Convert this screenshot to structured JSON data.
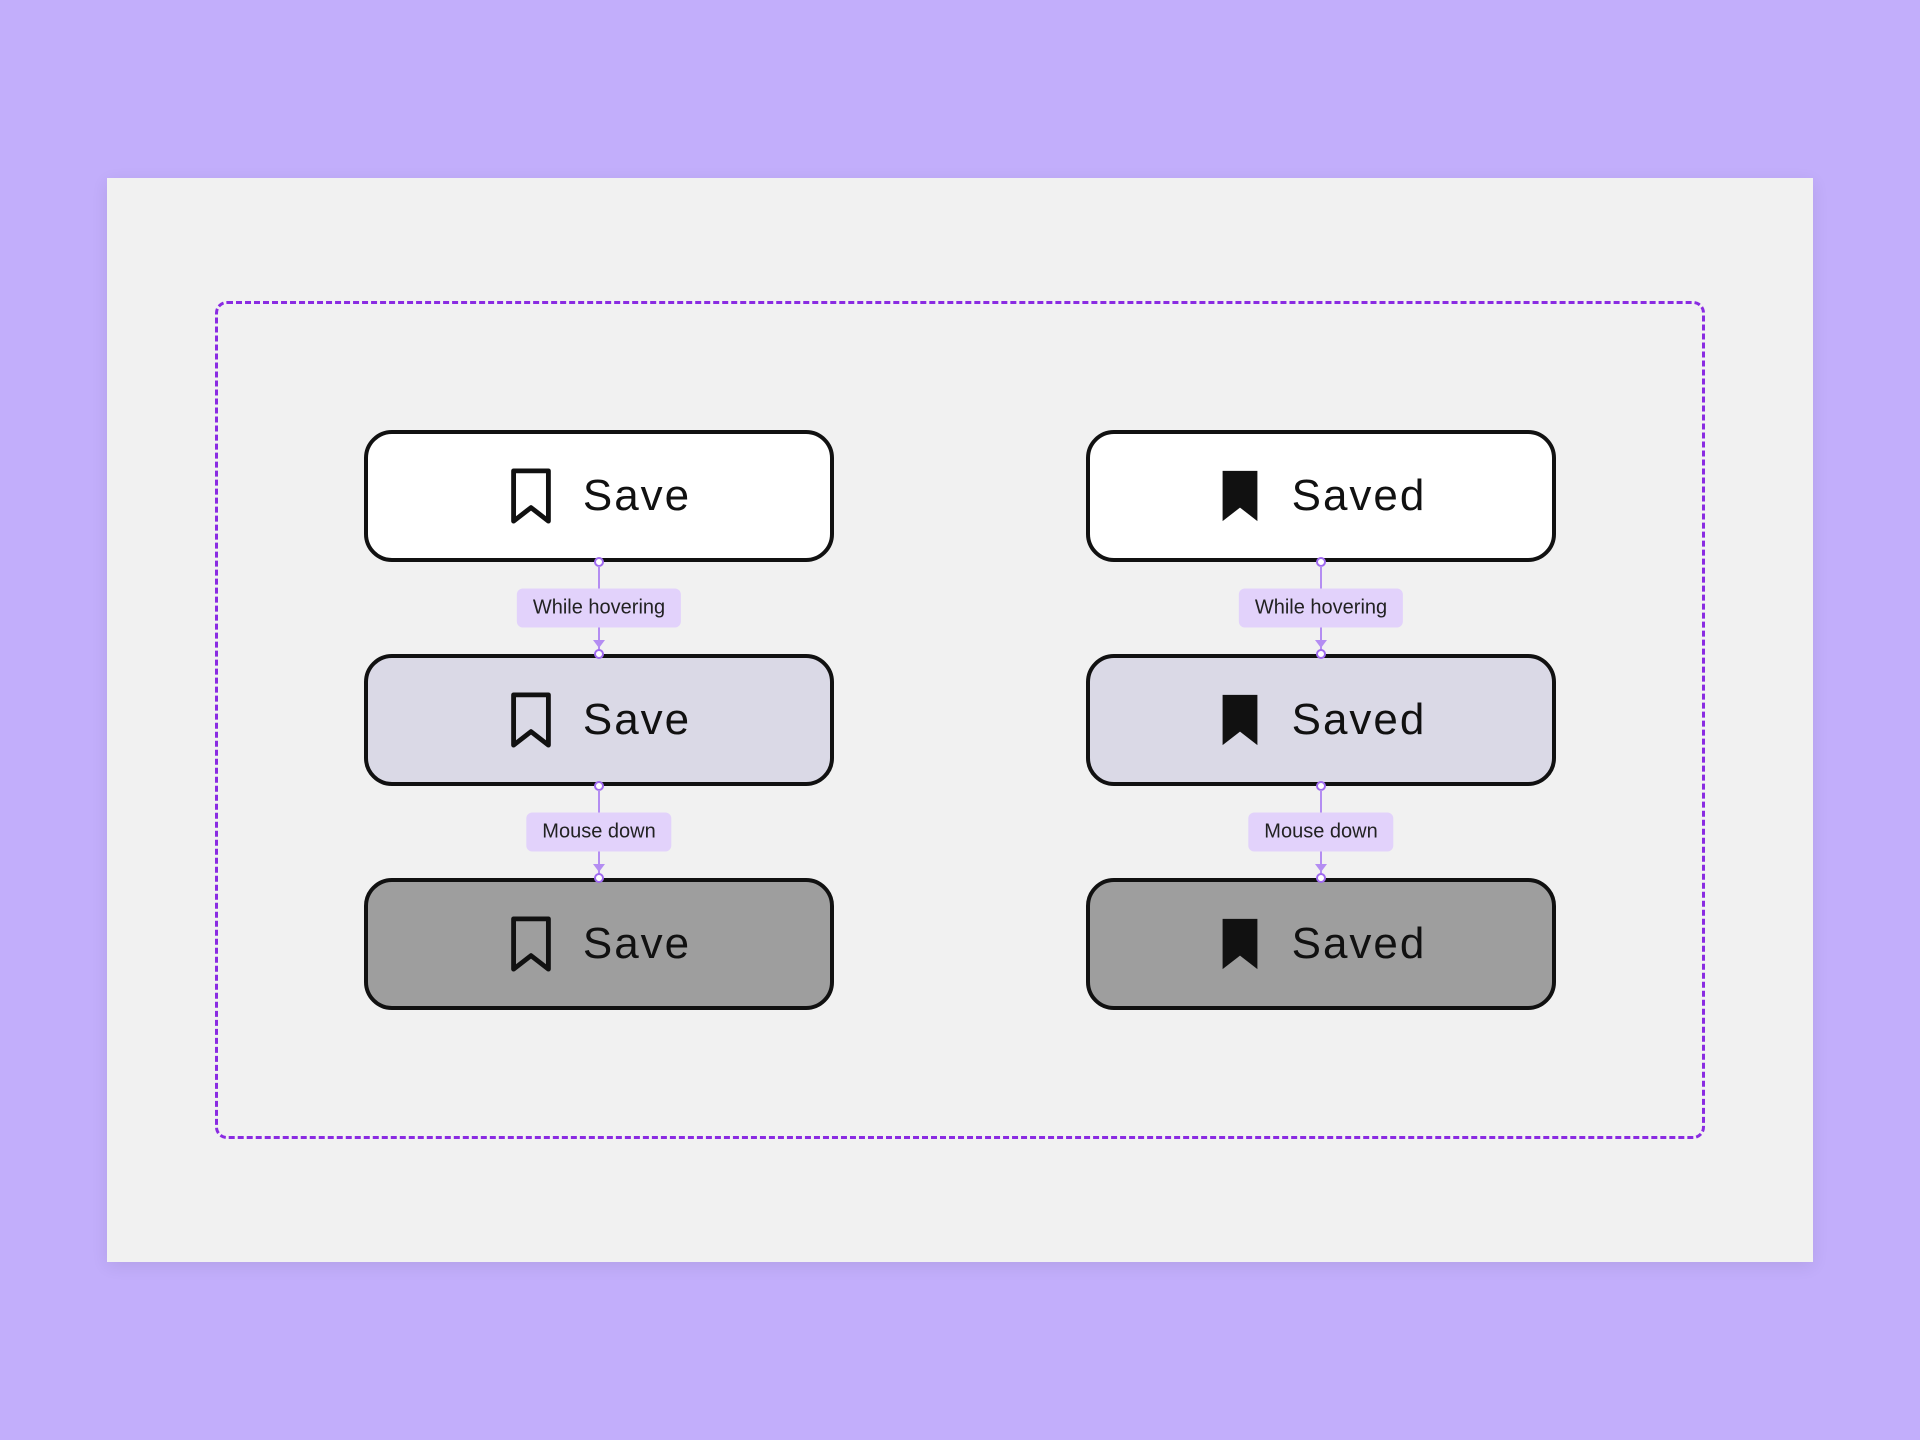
{
  "labels": {
    "save": "Save",
    "saved": "Saved"
  },
  "transitions": {
    "hover": "While hovering",
    "mousedown": "Mouse down"
  },
  "states": {
    "left": [
      {
        "state": "default",
        "label_key": "save",
        "icon": "bookmark-outline"
      },
      {
        "state": "hover",
        "label_key": "save",
        "icon": "bookmark-outline"
      },
      {
        "state": "pressed",
        "label_key": "save",
        "icon": "bookmark-outline"
      }
    ],
    "right": [
      {
        "state": "default",
        "label_key": "saved",
        "icon": "bookmark-filled"
      },
      {
        "state": "hover",
        "label_key": "saved",
        "icon": "bookmark-filled"
      },
      {
        "state": "pressed",
        "label_key": "saved",
        "icon": "bookmark-filled"
      }
    ]
  },
  "colors": {
    "page_bg": "#c2aefb",
    "card_bg": "#f1f1f1",
    "frame_border": "#8a2be2",
    "btn_default": "#ffffff",
    "btn_hover": "#dad9e6",
    "btn_pressed": "#9e9e9e",
    "trans_bg": "#e2d2fb"
  }
}
